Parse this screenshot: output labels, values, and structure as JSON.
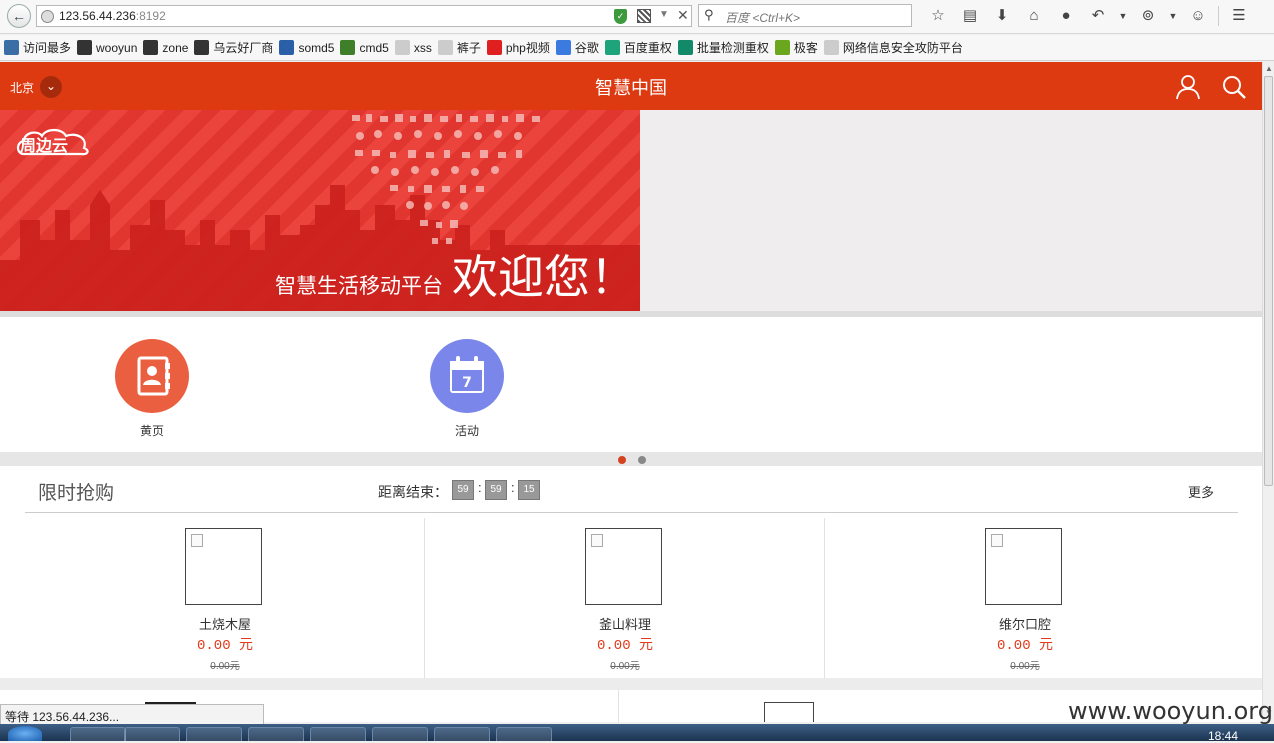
{
  "browser": {
    "url_host": "123.56.44.236",
    "url_port": ":8192",
    "search_placeholder": "百度 <Ctrl+K>",
    "bookmarks": [
      {
        "label": "访问最多",
        "color": "#3a6ea5"
      },
      {
        "label": "wooyun",
        "color": "#333333"
      },
      {
        "label": "zone",
        "color": "#333333"
      },
      {
        "label": "乌云好厂商",
        "color": "#333333"
      },
      {
        "label": "somd5",
        "color": "#2b5fa8"
      },
      {
        "label": "cmd5",
        "color": "#3f7f2a"
      },
      {
        "label": "xss",
        "color": "#cccccc"
      },
      {
        "label": "裤子",
        "color": "#cccccc"
      },
      {
        "label": "php视频",
        "color": "#e02020"
      },
      {
        "label": "谷歌",
        "color": "#3b7be0"
      },
      {
        "label": "百度重权",
        "color": "#1fa37a"
      },
      {
        "label": "批量检测重权",
        "color": "#128a6a"
      },
      {
        "label": "极客",
        "color": "#6aa61e"
      },
      {
        "label": "网络信息安全攻防平台",
        "color": "#cccccc"
      }
    ],
    "status_text": "等待 123.56.44.236...",
    "clock": "18:44"
  },
  "header": {
    "city": "北京",
    "title": "智慧中国",
    "accent": "#de3a12"
  },
  "banner": {
    "logo_text": "周边云",
    "subtitle": "智慧生活移动平台",
    "main": "欢迎您！"
  },
  "categories": [
    {
      "label": "黄页",
      "color": "#ea5f3f",
      "icon": "address-book-icon"
    },
    {
      "label": "活动",
      "color": "#7a86e9",
      "icon": "calendar-icon",
      "day": "7"
    }
  ],
  "carousel": {
    "active_index": 0,
    "count": 2
  },
  "flash_sale": {
    "title": "限时抢购",
    "countdown_label": "距离结束：",
    "hours": "59",
    "minutes": "59",
    "seconds": "15",
    "more": "更多",
    "products": [
      {
        "name": "土烧木屋",
        "price": "0.00 元",
        "old_price": "0.00元"
      },
      {
        "name": "釜山料理",
        "price": "0.00 元",
        "old_price": "0.00元"
      },
      {
        "name": "维尔口腔",
        "price": "0.00 元",
        "old_price": "0.00元"
      }
    ]
  },
  "watermark": "www.wooyun.org"
}
